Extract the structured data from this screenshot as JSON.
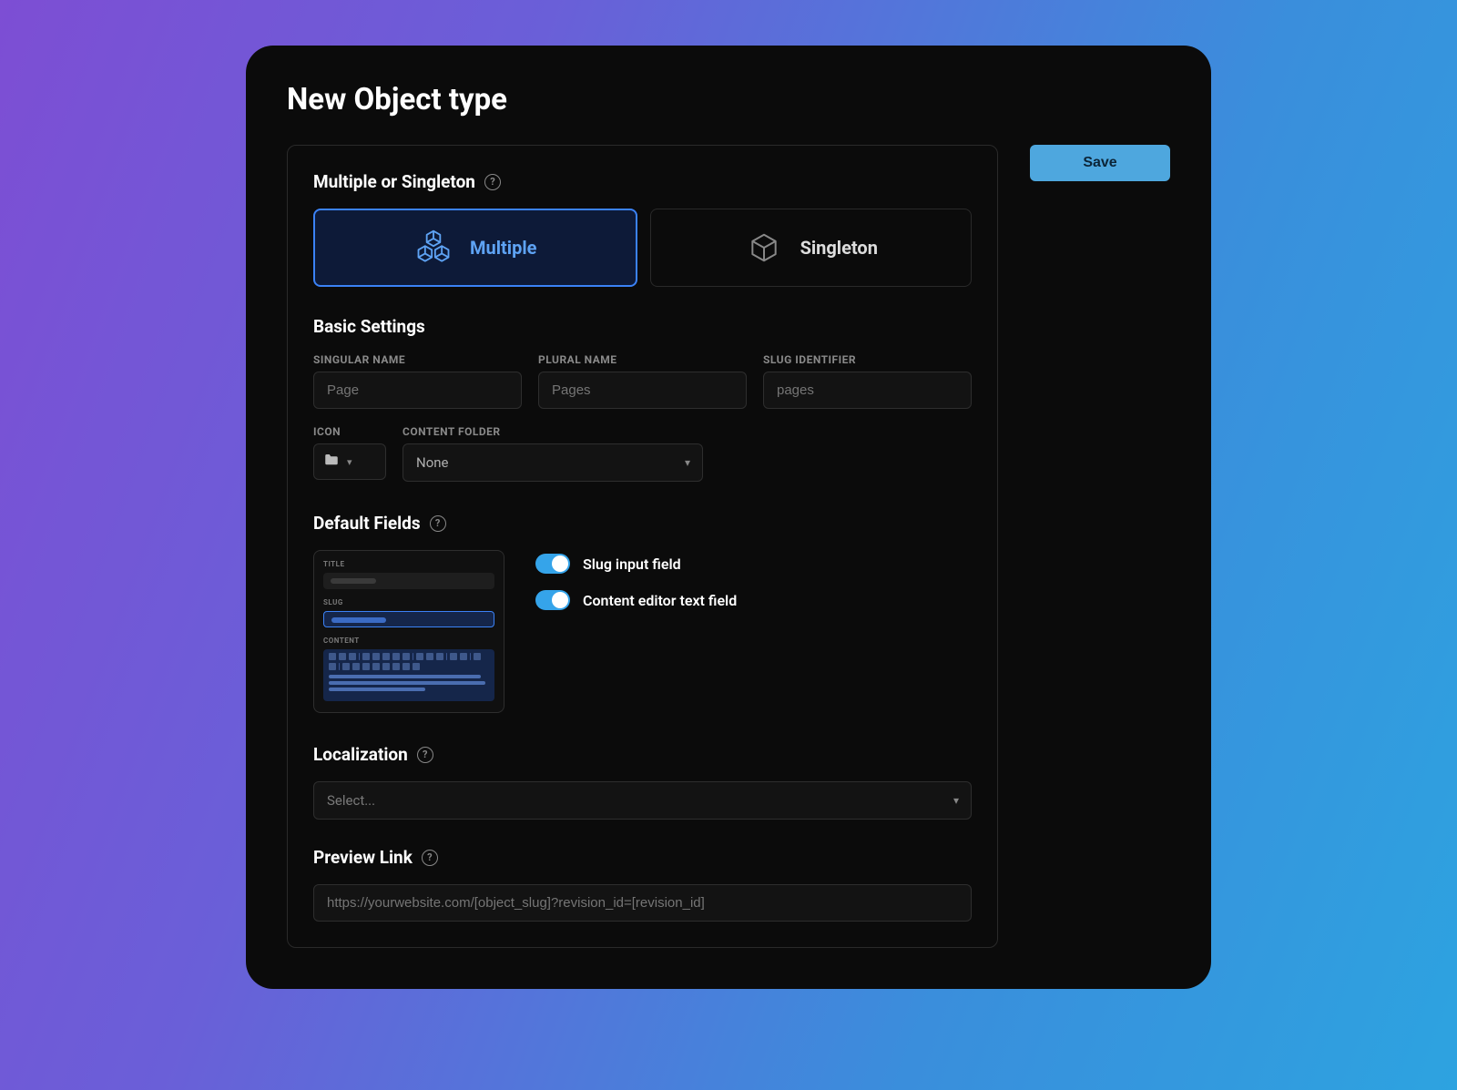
{
  "page_title": "New Object type",
  "save_button": "Save",
  "sections": {
    "type": {
      "title": "Multiple or Singleton",
      "options": {
        "multiple": "Multiple",
        "singleton": "Singleton"
      }
    },
    "basic": {
      "title": "Basic Settings",
      "labels": {
        "singular": "SINGULAR NAME",
        "plural": "PLURAL NAME",
        "slug_id": "SLUG IDENTIFIER",
        "icon": "ICON",
        "content_folder": "CONTENT FOLDER"
      },
      "placeholders": {
        "singular": "Page",
        "plural": "Pages",
        "slug_id": "pages"
      },
      "content_folder_value": "None"
    },
    "default_fields": {
      "title": "Default Fields",
      "preview": {
        "title": "TITLE",
        "slug": "SLUG",
        "content": "CONTENT"
      },
      "toggles": {
        "slug": "Slug input field",
        "content_editor": "Content editor text field"
      }
    },
    "localization": {
      "title": "Localization",
      "placeholder": "Select..."
    },
    "preview_link": {
      "title": "Preview Link",
      "placeholder": "https://yourwebsite.com/[object_slug]?revision_id=[revision_id]"
    }
  }
}
